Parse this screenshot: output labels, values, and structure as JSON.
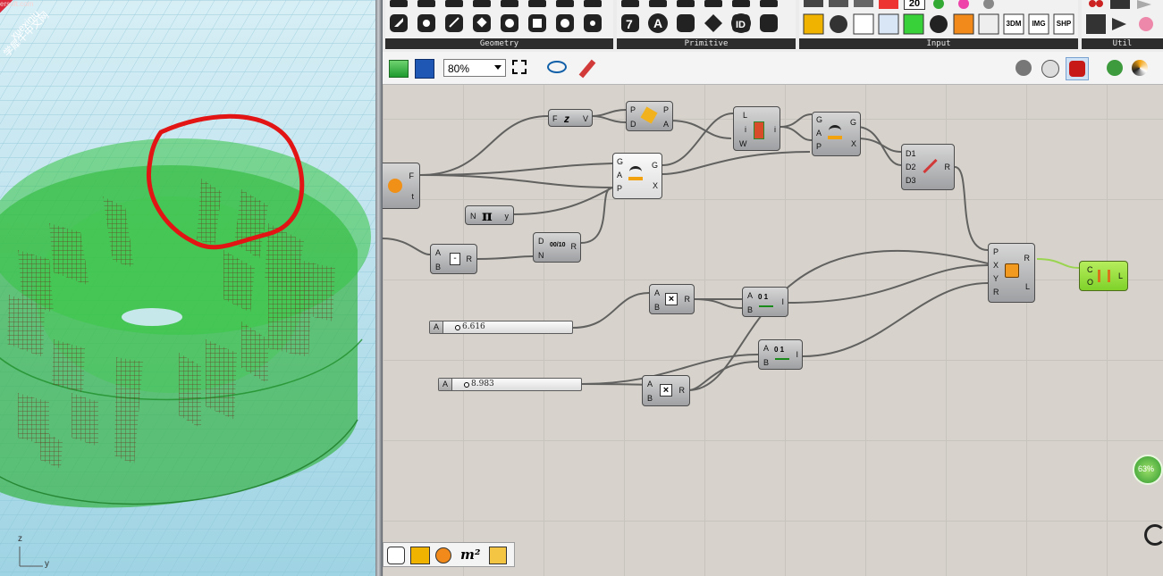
{
  "viewport": {
    "watermark": {
      "brand": "xuexiniu",
      "site": "学犀牛中文网",
      "partial_url": "ersoft.com"
    },
    "axes": {
      "z": "z",
      "y": "y"
    }
  },
  "ribbon": {
    "panels": [
      {
        "label": "Geometry"
      },
      {
        "label": "Primitive"
      },
      {
        "label": "Input"
      },
      {
        "label": "Util"
      }
    ],
    "input_icons": [
      "20",
      "3DM",
      "IMG",
      "SHP"
    ]
  },
  "toolbar": {
    "zoom": "80%",
    "icons": [
      "open-file-icon",
      "save-file-icon",
      "zoom-extents-icon",
      "preview-eye-icon",
      "sketch-pen-icon"
    ]
  },
  "components": {
    "merge_top": {
      "in": [
        "F",
        "t"
      ],
      "out": []
    },
    "deconstruct_z": {
      "in": [
        "F"
      ],
      "out": [
        "V"
      ]
    },
    "plane_normal": {
      "in": [
        "P",
        "D"
      ],
      "out": [
        "P",
        "A"
      ]
    },
    "list_item": {
      "in": [
        "L",
        "i",
        "W"
      ],
      "out": [
        "i"
      ]
    },
    "rotate_top": {
      "in": [
        "G",
        "A",
        "P"
      ],
      "out": [
        "G",
        "X"
      ]
    },
    "rotate_mid": {
      "in": [
        "G",
        "A",
        "P"
      ],
      "out": [
        "G",
        "X"
      ]
    },
    "merge_d": {
      "in": [
        "D1",
        "D2",
        "D3"
      ],
      "out": [
        "R"
      ]
    },
    "pi": {
      "in": [
        "N"
      ],
      "symbol": "π",
      "out": [
        "y"
      ]
    },
    "subtract": {
      "in": [
        "A",
        "B"
      ],
      "symbol": "-",
      "out": [
        "R"
      ]
    },
    "division": {
      "in": [
        "D",
        "N"
      ],
      "symbol": "00/10",
      "out": [
        "R"
      ]
    },
    "multiply_1": {
      "in": [
        "A",
        "B"
      ],
      "symbol": "×",
      "out": [
        "R"
      ]
    },
    "multiply_2": {
      "in": [
        "A",
        "B"
      ],
      "symbol": "×",
      "out": [
        "R"
      ]
    },
    "range_1": {
      "in": [
        "A",
        "B"
      ],
      "symbol": "0 1",
      "out": [
        "I"
      ]
    },
    "range_2": {
      "in": [
        "A",
        "B"
      ],
      "symbol": "0 1",
      "out": [
        "I"
      ]
    },
    "graph_mapper": {
      "in": [
        "P",
        "X",
        "Y",
        "R"
      ],
      "out": [
        "R",
        "L"
      ]
    },
    "lines": {
      "in": [
        "C",
        "O"
      ],
      "out": [
        "L"
      ]
    }
  },
  "sliders": [
    {
      "tag": "A",
      "value": "6.616"
    },
    {
      "tag": "A",
      "value": "8.983"
    }
  ],
  "status": {
    "progress_label": "63%",
    "progress": 0.63
  },
  "bottom_icons": [
    "sphere-icon",
    "graph-icon",
    "clock-icon",
    "area-icon",
    "arrow-up-icon"
  ],
  "bottom_area_label": "m²"
}
